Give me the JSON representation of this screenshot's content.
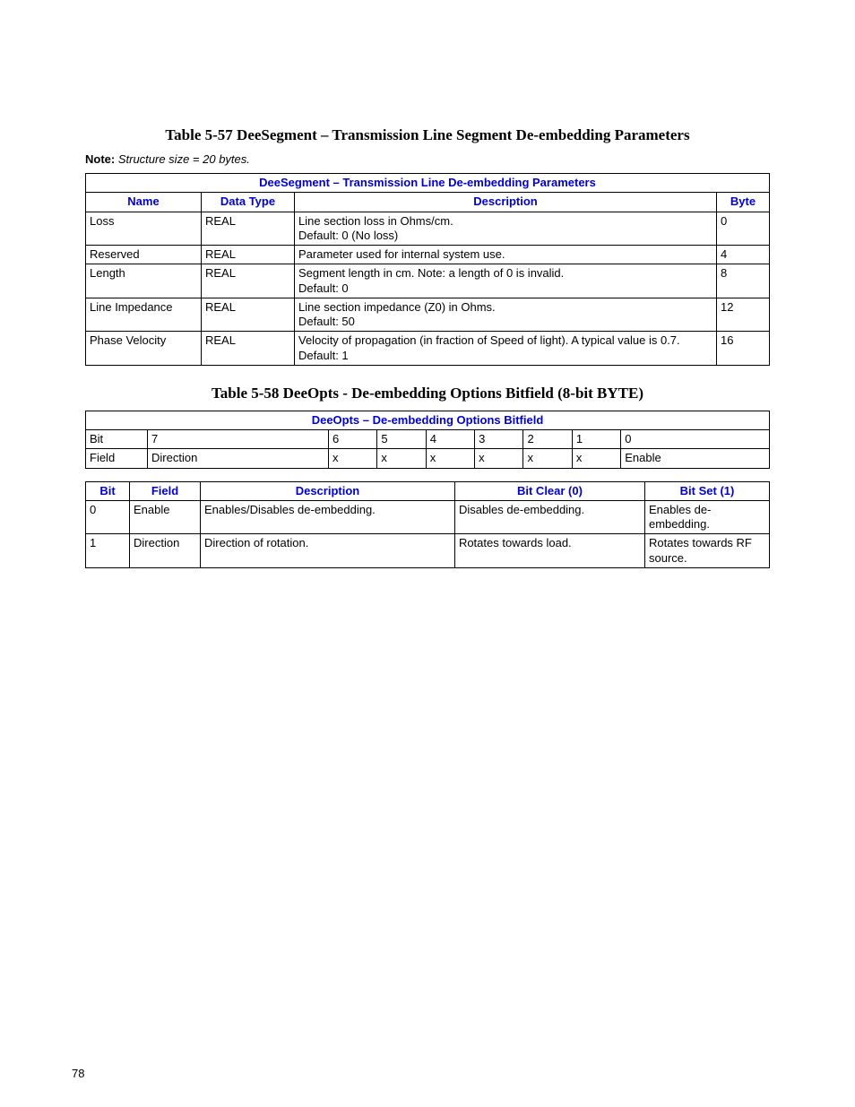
{
  "page_number": "78",
  "caption1": "Table 5-57   DeeSegment – Transmission Line Segment De-embedding Parameters",
  "note1_label": "Note:",
  "note1_text": "  Structure size = 20 bytes.",
  "t1_title": "DeeSegment – Transmission Line De-embedding Parameters",
  "t1_h": {
    "c1": "Name",
    "c2": "Data Type",
    "c3": "Description",
    "c4": "Byte"
  },
  "t1_r1": {
    "c1": "Loss",
    "c2": "REAL",
    "c3": "Line section loss in Ohms/cm.\nDefault: 0 (No loss)",
    "c4": "0"
  },
  "t1_r2": {
    "c1": "Reserved",
    "c2": "REAL",
    "c3": "Parameter used for internal system use.",
    "c4": "4"
  },
  "t1_r3": {
    "c1": "Length",
    "c2": "REAL",
    "c3": "Segment length in cm. Note: a length of 0 is invalid.\nDefault: 0",
    "c4": "8"
  },
  "t1_r4": {
    "c1": "Line Impedance",
    "c2": "REAL",
    "c3": "Line section impedance (Z0) in Ohms.\nDefault: 50",
    "c4": "12"
  },
  "t1_r5": {
    "c1": "Phase Velocity",
    "c2": "REAL",
    "c3": "Velocity of propagation (in fraction of Speed of light). A typical value is 0.7.\nDefault: 1",
    "c4": "16"
  },
  "caption2": "Table 5-58   DeeOpts - De-embedding Options Bitfield (8-bit BYTE)",
  "t2_title": "DeeOpts – De-embedding Options Bitfield",
  "t2_r1": {
    "c0": "Bit",
    "c1": "7",
    "c2": "6",
    "c3": "5",
    "c4": "4",
    "c5": "3",
    "c6": "2",
    "c7": "1",
    "c8": "0"
  },
  "t2_r2": {
    "c0": "Field",
    "c1": "Direction",
    "c2": "x",
    "c3": "x",
    "c4": "x",
    "c5": "x",
    "c6": "x",
    "c7": "x",
    "c8": "Enable"
  },
  "t3_h": {
    "c1": "Bit",
    "c2": "Field",
    "c3": "Description",
    "c4": "Bit Clear (0)",
    "c5": "Bit Set (1)"
  },
  "t3_r1": {
    "c1": "0",
    "c2": "Enable",
    "c3": "Enables/Disables de-embedding.",
    "c4": "Disables de-embedding.",
    "c5": "Enables de-embedding."
  },
  "t3_r2": {
    "c1": "1",
    "c2": "Direction",
    "c3": "Direction of rotation.",
    "c4": "Rotates towards load.",
    "c5": "Rotates towards RF source."
  }
}
